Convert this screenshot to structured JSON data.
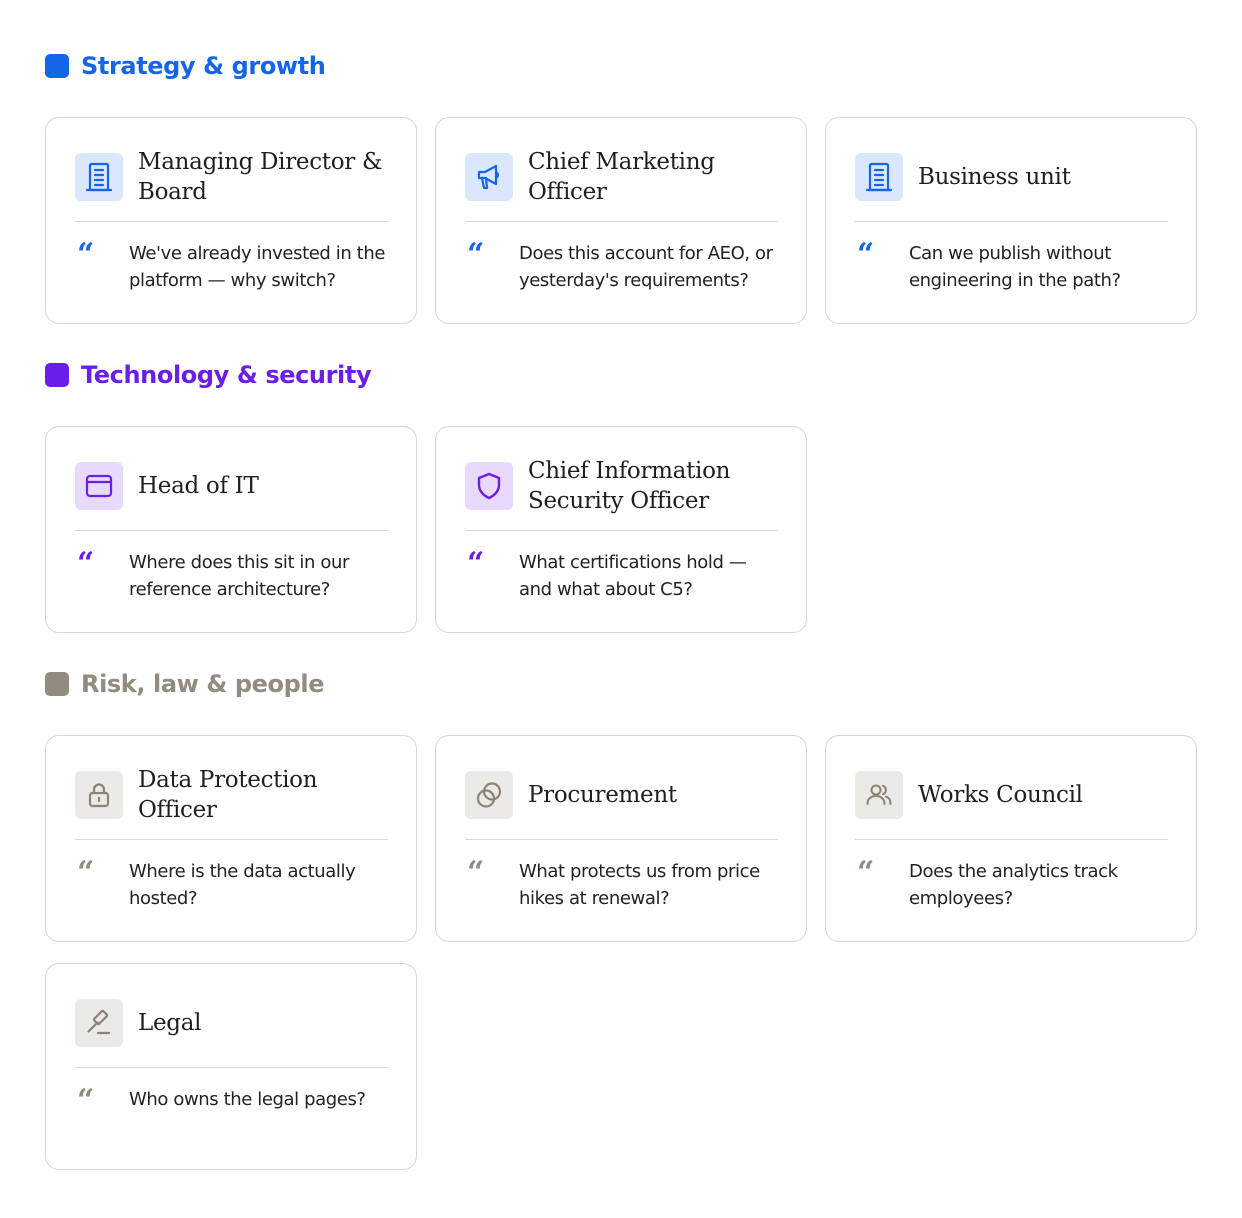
{
  "colors": {
    "strategy": "#1565e9",
    "technology": "#6a1fe8",
    "risk": "#928b80"
  },
  "sections": [
    {
      "title": "Strategy & growth",
      "cards": [
        {
          "title": "Managing Director & Board",
          "icon": "building-icon",
          "quote": "We've already invested in the platform — why switch?"
        },
        {
          "title": "Chief Marketing Officer",
          "icon": "megaphone-icon",
          "quote": "Does this account for AEO, or yesterday's requirements?"
        },
        {
          "title": "Business unit",
          "icon": "building-icon",
          "quote": "Can we publish without engineering in the path?"
        }
      ]
    },
    {
      "title": "Technology & security",
      "cards": [
        {
          "title": "Head of IT",
          "icon": "browser-window-icon",
          "quote": "Where does this sit in our reference architecture?"
        },
        {
          "title": "Chief Information Security Officer",
          "icon": "shield-icon",
          "quote": "What certifications hold — and what about C5?"
        }
      ]
    },
    {
      "title": "Risk, law & people",
      "cards": [
        {
          "title": "Data Protection Officer",
          "icon": "lock-icon",
          "quote": "Where is the data actually hosted?"
        },
        {
          "title": "Procurement",
          "icon": "coins-icon",
          "quote": "What protects us from price hikes at renewal?"
        },
        {
          "title": "Works Council",
          "icon": "users-icon",
          "quote": "Does the analytics track employees?"
        },
        {
          "title": "Legal",
          "icon": "gavel-icon",
          "quote": "Who owns the legal pages?"
        }
      ]
    }
  ],
  "quote_glyph": "“"
}
